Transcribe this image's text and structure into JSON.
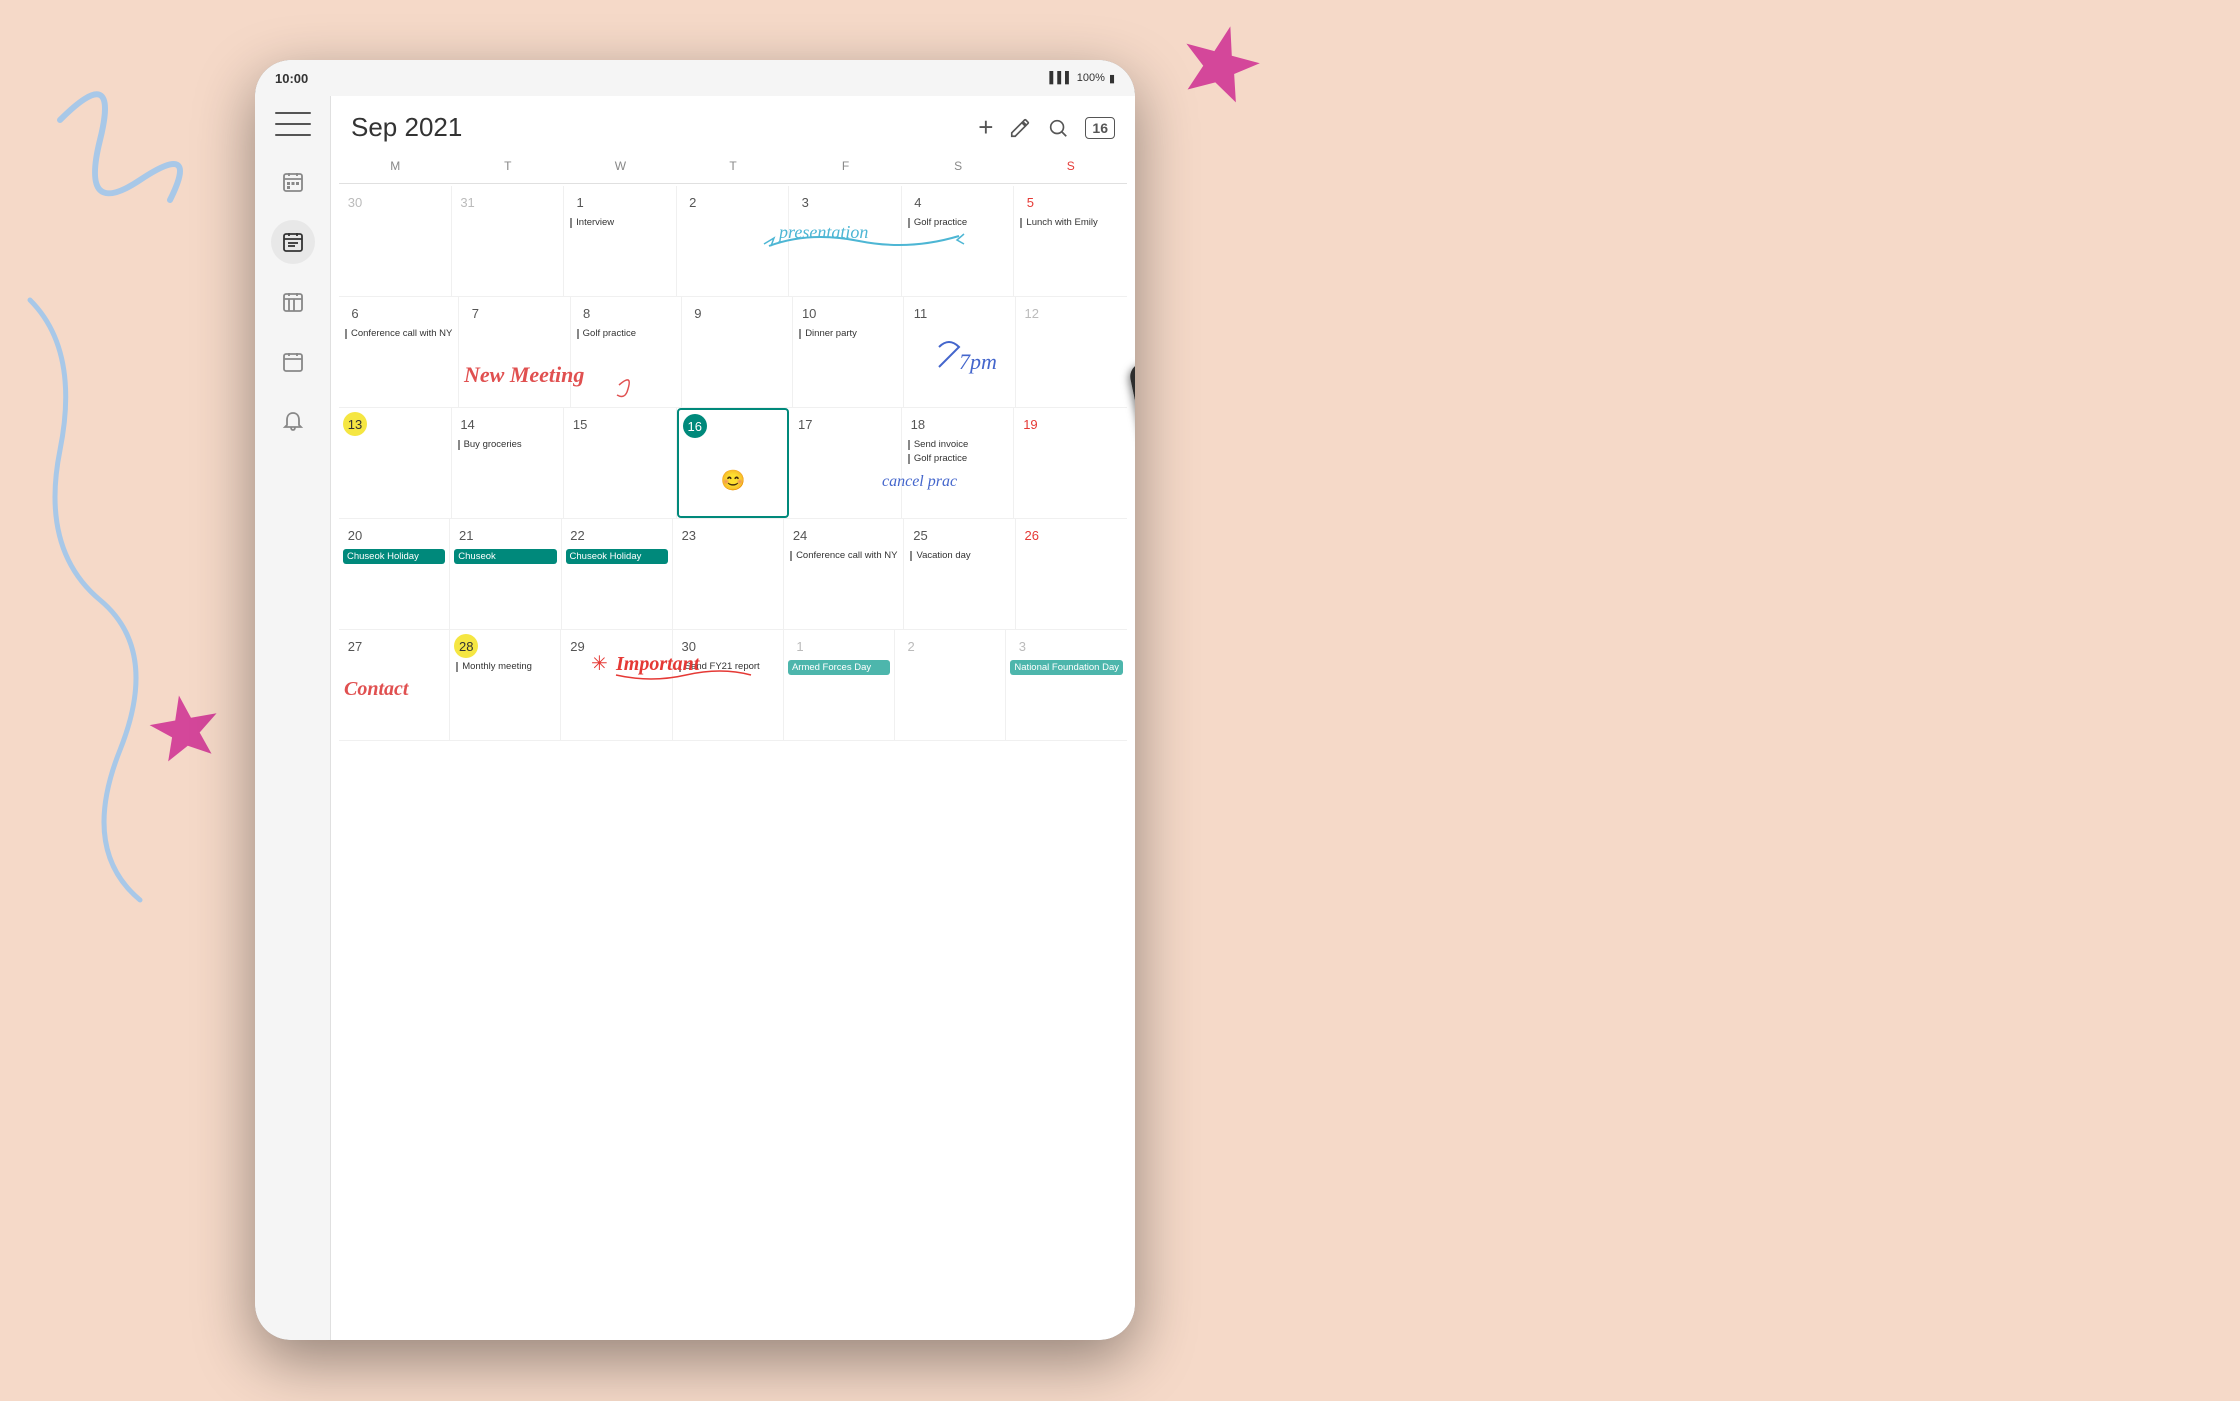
{
  "background": {
    "color": "#f5d9c8"
  },
  "statusBar": {
    "time": "10:00",
    "signal": "▌▌▌",
    "battery": "100%",
    "batteryIcon": "🔋"
  },
  "header": {
    "menuIcon": "≡",
    "title": "Sep 2021",
    "addIcon": "+",
    "penIcon": "✎",
    "searchIcon": "🔍",
    "calIcon": "16"
  },
  "dayHeaders": [
    "M",
    "T",
    "W",
    "T",
    "F",
    "S",
    "S"
  ],
  "weeks": [
    {
      "days": [
        {
          "num": "30",
          "grey": true,
          "events": []
        },
        {
          "num": "31",
          "grey": true,
          "events": []
        },
        {
          "num": "1",
          "events": [
            {
              "type": "line",
              "text": "Interview"
            }
          ]
        },
        {
          "num": "2",
          "events": []
        },
        {
          "num": "3",
          "events": []
        },
        {
          "num": "4",
          "events": [
            {
              "type": "line",
              "text": "Golf practice"
            }
          ]
        },
        {
          "num": "5",
          "sunday": true,
          "events": [
            {
              "type": "line",
              "text": "Lunch with Emily"
            }
          ]
        }
      ]
    },
    {
      "days": [
        {
          "num": "6",
          "events": [
            {
              "type": "line",
              "text": "Conference call with NY"
            }
          ]
        },
        {
          "num": "7",
          "events": []
        },
        {
          "num": "8",
          "events": [
            {
              "type": "line",
              "text": "Golf practice"
            }
          ]
        },
        {
          "num": "9",
          "events": []
        },
        {
          "num": "10",
          "events": [
            {
              "type": "line",
              "text": "Dinner party"
            }
          ]
        },
        {
          "num": "11",
          "events": []
        },
        {
          "num": "12",
          "sunday": true,
          "grey": true,
          "events": []
        }
      ]
    },
    {
      "days": [
        {
          "num": "13",
          "highlighted": true,
          "events": []
        },
        {
          "num": "14",
          "events": [
            {
              "type": "line",
              "text": "Buy groceries"
            }
          ]
        },
        {
          "num": "15",
          "events": []
        },
        {
          "num": "16",
          "today": true,
          "events": [
            {
              "type": "emoji",
              "text": "😊"
            }
          ]
        },
        {
          "num": "17",
          "events": []
        },
        {
          "num": "18",
          "events": [
            {
              "type": "line",
              "text": "Send invoice"
            },
            {
              "type": "line",
              "text": "Golf practice"
            }
          ]
        },
        {
          "num": "19",
          "sunday": true,
          "events": []
        }
      ]
    },
    {
      "days": [
        {
          "num": "20",
          "events": [
            {
              "type": "greenbar",
              "text": "Chuseok Holiday"
            }
          ]
        },
        {
          "num": "21",
          "events": [
            {
              "type": "greenbar",
              "text": "Chuseok"
            }
          ]
        },
        {
          "num": "22",
          "events": [
            {
              "type": "greenbar",
              "text": "Chuseok Holiday"
            }
          ]
        },
        {
          "num": "23",
          "events": []
        },
        {
          "num": "24",
          "events": [
            {
              "type": "line",
              "text": "Conference call with NY"
            }
          ]
        },
        {
          "num": "25",
          "events": [
            {
              "type": "line",
              "text": "Vacation day"
            }
          ]
        },
        {
          "num": "26",
          "sunday": true,
          "events": []
        }
      ]
    },
    {
      "days": [
        {
          "num": "27",
          "events": []
        },
        {
          "num": "28",
          "highlighted": true,
          "events": [
            {
              "type": "line",
              "text": "Monthly meeting"
            }
          ]
        },
        {
          "num": "29",
          "events": []
        },
        {
          "num": "30",
          "events": [
            {
              "type": "line",
              "text": "Send FY21 report"
            }
          ]
        },
        {
          "num": "1",
          "grey": true,
          "events": [
            {
              "type": "tealbar",
              "text": "Armed Forces Day"
            }
          ]
        },
        {
          "num": "2",
          "grey": true,
          "events": []
        },
        {
          "num": "3",
          "grey": true,
          "sunday": true,
          "events": [
            {
              "type": "tealbar",
              "text": "National Foundation Day"
            }
          ]
        }
      ]
    }
  ],
  "handwriting": {
    "presentation": "presentation",
    "newMeeting": "New Meeting",
    "sevenPm": "7pm",
    "cancelPrac": "cancel prac",
    "important": "Important",
    "contact": "Contact"
  },
  "sidebar": {
    "icons": [
      "menu",
      "calendar-month",
      "calendar-agenda",
      "calendar-week",
      "calendar-day",
      "bell"
    ]
  }
}
